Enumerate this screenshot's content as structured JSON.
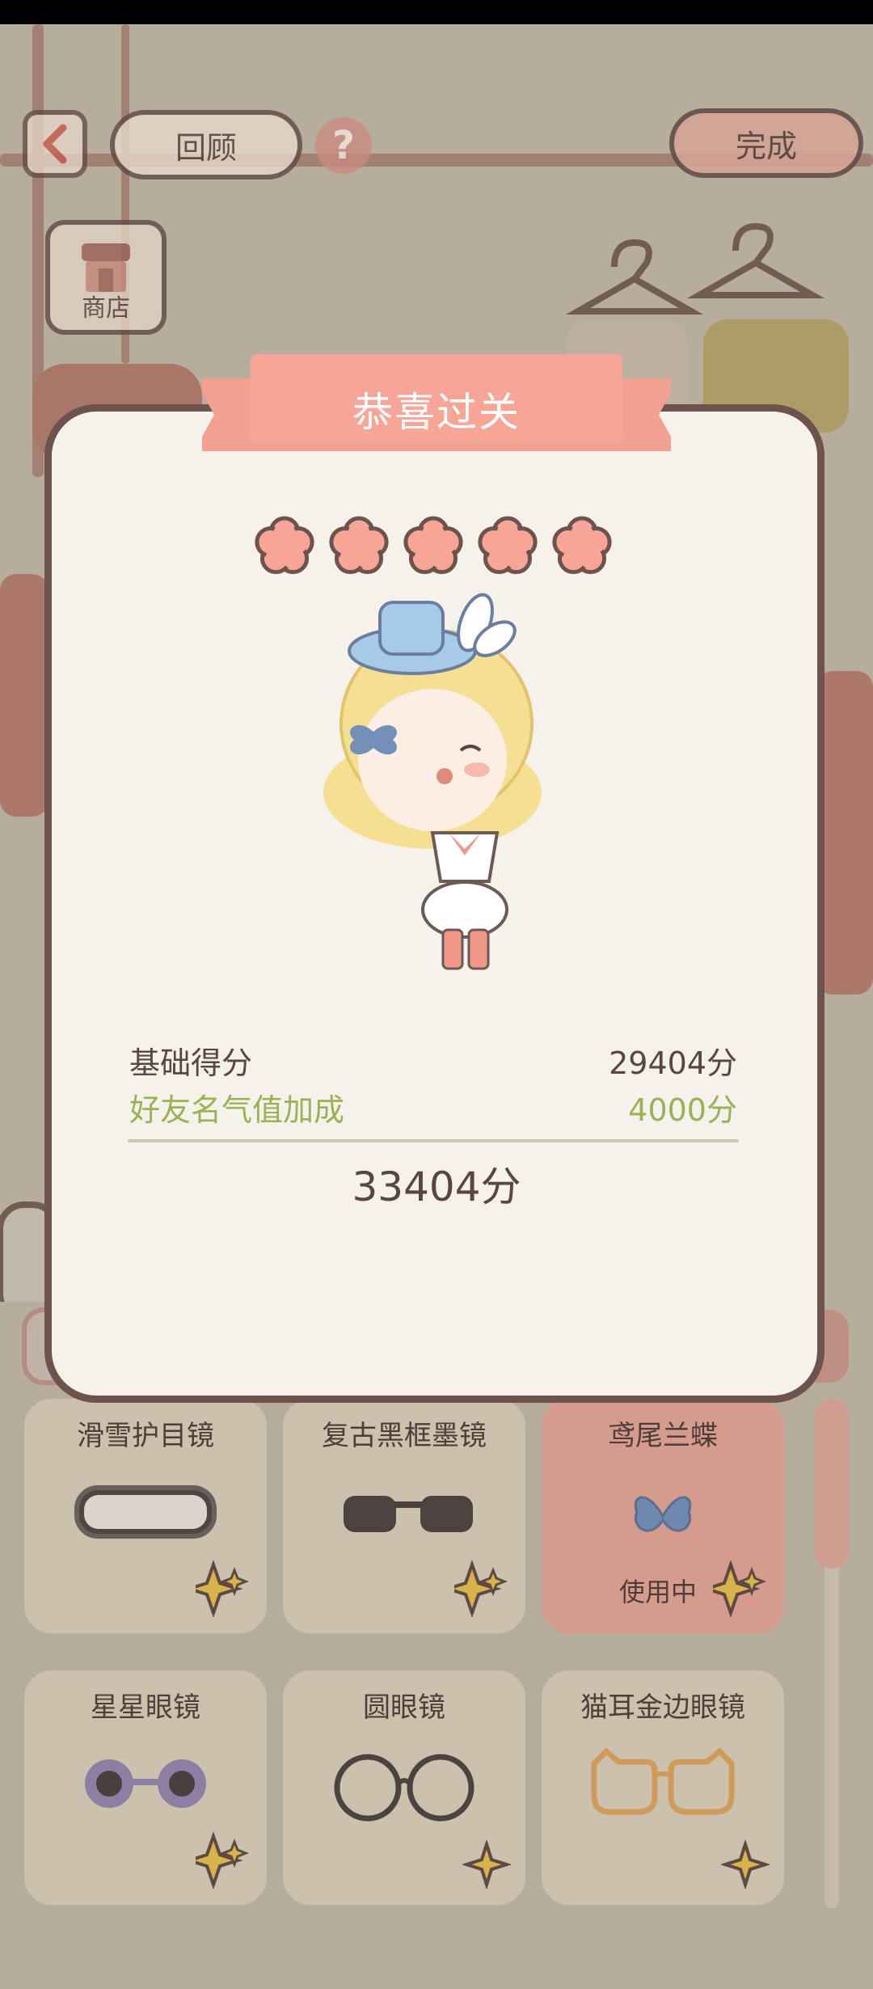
{
  "header": {
    "back_icon": "chevron-left-icon",
    "review_label": "回顾",
    "help_label": "?",
    "done_label": "完成"
  },
  "shop": {
    "label": "商店",
    "icon": "shop-icon"
  },
  "modal": {
    "title": "恭喜过关",
    "stars": 5,
    "base_score_label": "基础得分",
    "base_score_value": "29404分",
    "bonus_label": "好友名气值加成",
    "bonus_value": "4000分",
    "total": "33404分"
  },
  "items": [
    {
      "name": "滑雪护目镜",
      "icon": "ski-goggles-icon",
      "using": false
    },
    {
      "name": "复古黑框墨镜",
      "icon": "sunglasses-icon",
      "using": false
    },
    {
      "name": "鸢尾兰蝶",
      "icon": "butterfly-icon",
      "using": true,
      "using_label": "使用中"
    },
    {
      "name": "星星眼镜",
      "icon": "flower-glasses-icon",
      "using": false
    },
    {
      "name": "圆眼镜",
      "icon": "round-glasses-icon",
      "using": false
    },
    {
      "name": "猫耳金边眼镜",
      "icon": "cat-ear-glasses-icon",
      "using": false
    }
  ],
  "colors": {
    "accent": "#f4a596",
    "bonus_green": "#9bb155",
    "text_brown": "#5a4540",
    "frame_brown": "#6c534b"
  }
}
